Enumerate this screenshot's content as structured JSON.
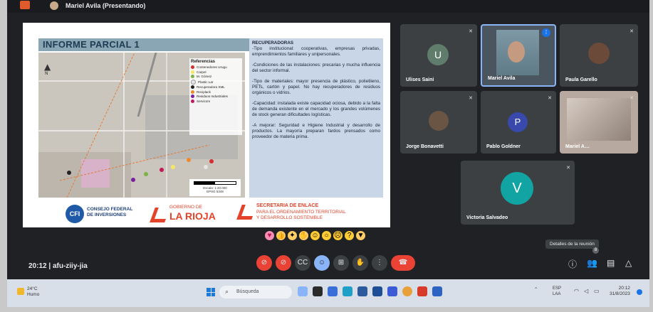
{
  "presenting": "Mariel Avila (Presentando)",
  "slide": {
    "title": "INFORME PARCIAL 1",
    "legend_title": "Referencias",
    "legend": [
      {
        "label": "Contenedores Urugu",
        "color": "#d32f2f"
      },
      {
        "label": "Carpel",
        "color": "#f5e663"
      },
      {
        "label": "M. Gómez",
        "color": "#7cb342"
      },
      {
        "label": "Plastic Lar",
        "color": "#e6e6e6"
      },
      {
        "label": "Recuperadora SML",
        "color": "#222222"
      },
      {
        "label": "Reciplack",
        "color": "#ef8a2a"
      },
      {
        "label": "Residuos Industriales",
        "color": "#7b1fa2"
      },
      {
        "label": "Servicom",
        "color": "#c2185b"
      }
    ],
    "scale_label": "Escala: 1:20.000",
    "scale_sub": "EPSG 5348",
    "heading": "RECUPERADORAS",
    "paragraphs": [
      "-Tipo institucional: cooperativas, empresas privadas, emprendimientos familiares y unipersonales.",
      "-Condiciones de las instalaciones: precarias y mucha influencia del sector informal.",
      "-Tipo de materiales: mayor presencia de plástico, polietileno, PETs, cartón y papel. No hay recuperadores de residuos orgánicos o vidrios.",
      "-Capacidad: instalada existe capacidad ociosa, debido a la falta de demanda existente en el mercado y los grandes volúmenes de stock generan dificultades logísticas.",
      "-A mejorar: Seguridad e Higiene Industrial y desarrollo de productos. La mayoría preparan fardos prensados como proveedor de materia prima."
    ],
    "logos": {
      "cfi_mark": "CFI",
      "cfi_line1": "CONSEJO FEDERAL",
      "cfi_line2": "DE INVERSIONES",
      "rioja_line1": "GOBIERNO DE",
      "rioja_line2": "LA RIOJA",
      "sec_line1": "SECRETARIA DE ENLACE",
      "sec_line2": "PARA EL ORDENAMIENTO TERRITORIAL",
      "sec_line3": "Y DESARROLLO SOSTENIBLE"
    }
  },
  "participants": [
    {
      "name": "Ulises Saini",
      "initial": "U",
      "color": "#5f7d6a"
    },
    {
      "name": "Mariel Avila",
      "initial": "",
      "color": "#8aa"
    },
    {
      "name": "Paula Garello",
      "initial": "",
      "color": "#6b4a3a"
    },
    {
      "name": "Jorge Bonavetti",
      "initial": "",
      "color": "#6a5444"
    },
    {
      "name": "Pablo Goldner",
      "initial": "P",
      "color": "#3949ab"
    },
    {
      "name": "Mariel A…",
      "initial": "",
      "color": "#b7a9a0"
    },
    {
      "name": "Victoria Salvadeo",
      "initial": "V",
      "color": "#12a3a3"
    }
  ],
  "meeting": {
    "time": "20:12",
    "code": "afu-ziiy-jia",
    "separator": "|",
    "tooltip": "Detalles de la reunión",
    "people_count": "8"
  },
  "taskbar": {
    "temp": "24°C",
    "weather": "Humo",
    "search": "Búsqueda",
    "lang1": "ESP",
    "lang2": "LAA",
    "time": "20:12",
    "date": "31/8/2023"
  }
}
